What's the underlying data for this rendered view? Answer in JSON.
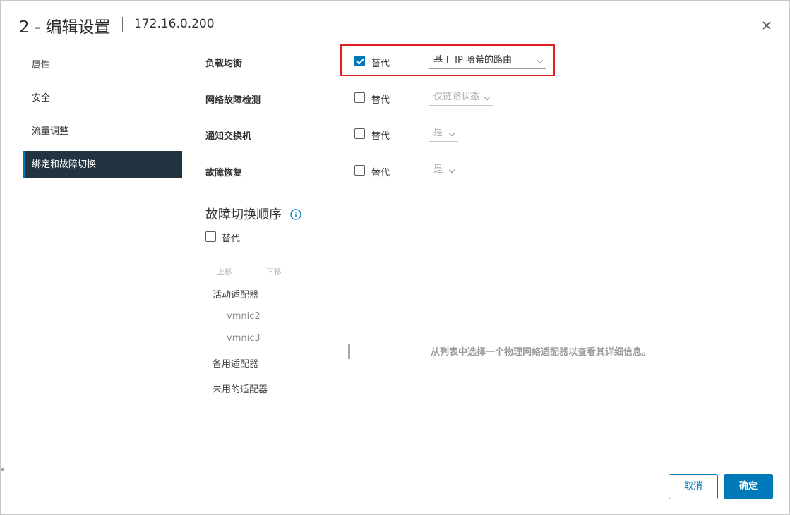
{
  "dialog": {
    "title": "2 - 编辑设置",
    "subtitle": "172.16.0.200",
    "close_icon": "close-icon"
  },
  "nav": {
    "items": [
      {
        "label": "属性"
      },
      {
        "label": "安全"
      },
      {
        "label": "流量调整"
      },
      {
        "label": "绑定和故障切换",
        "active": true
      }
    ]
  },
  "settings": {
    "load_balancing": {
      "label": "负载均衡",
      "override_label": "替代",
      "override_checked": true,
      "value": "基于 IP 哈希的路由"
    },
    "network_failure_detection": {
      "label": "网络故障检测",
      "override_label": "替代",
      "override_checked": false,
      "value": "仅链路状态"
    },
    "notify_switches": {
      "label": "通知交换机",
      "override_label": "替代",
      "override_checked": false,
      "value": "是"
    },
    "failback": {
      "label": "故障恢复",
      "override_label": "替代",
      "override_checked": false,
      "value": "是"
    }
  },
  "failover_order": {
    "title": "故障切换顺序",
    "info_icon": "info-icon",
    "override_label": "替代",
    "override_checked": false,
    "move_up": "上移",
    "move_down": "下移",
    "active_adapters": "活动适配器",
    "active_nics": [
      "vmnic2",
      "vmnic3"
    ],
    "standby_adapters": "备用适配器",
    "unused_adapters": "未用的适配器",
    "detail_message": "从列表中选择一个物理网络适配器以查看其详细信息。"
  },
  "footer": {
    "cancel_label": "取消",
    "ok_label": "确定"
  },
  "colors": {
    "accent": "#0079b8",
    "nav_active_bg": "#22343f",
    "highlight": "#e02020"
  }
}
